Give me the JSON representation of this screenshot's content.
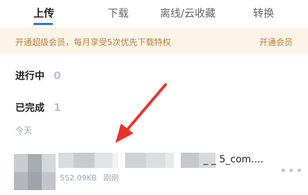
{
  "tabs": [
    {
      "label": "上传",
      "active": true
    },
    {
      "label": "下载",
      "active": false
    },
    {
      "label": "离线/云收藏",
      "active": false
    },
    {
      "label": "转换",
      "active": false
    }
  ],
  "banner": {
    "text": "开通超级会员，每月享受5次优先下载特权",
    "link": "开通会员"
  },
  "sections": {
    "in_progress": {
      "label": "进行中",
      "count": "0"
    },
    "completed": {
      "label": "已完成",
      "count": "1"
    }
  },
  "date_group": "今天",
  "file": {
    "name_tail": "_           _        5_com....",
    "size": "552.09KB",
    "time": "刚刚",
    "more_icon": "more-dots-icon"
  },
  "colors": {
    "accent": "#2f6cf6",
    "banner_bg": "#fdf3e6",
    "banner_text": "#b8803a",
    "arrow": "#e8332b"
  }
}
